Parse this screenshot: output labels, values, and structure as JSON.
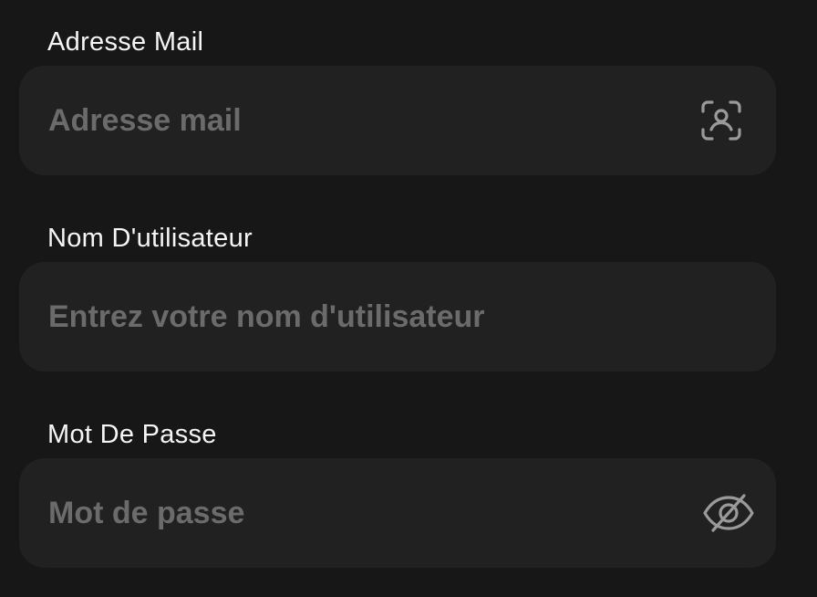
{
  "form": {
    "email": {
      "label": "Adresse Mail",
      "placeholder": "Adresse mail",
      "value": "",
      "icon": "face-scan-icon"
    },
    "username": {
      "label": "Nom D'utilisateur",
      "placeholder": "Entrez votre nom d'utilisateur",
      "value": ""
    },
    "password": {
      "label": "Mot De Passe",
      "placeholder": "Mot de passe",
      "value": "",
      "icon": "eye-off-icon"
    }
  },
  "colors": {
    "background": "#171717",
    "field_background": "#212121",
    "label_text": "#f5f5f5",
    "placeholder_text": "#6b6b6b",
    "icon": "#9a9a9a"
  }
}
